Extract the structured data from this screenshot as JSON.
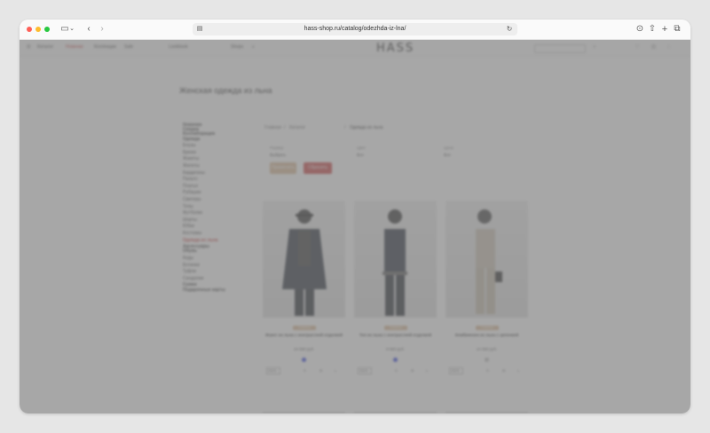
{
  "browser": {
    "url": "hass-shop.ru/catalog/odezhda-iz-lna/",
    "traffic_lights": {
      "close": "#ff5f57",
      "minimize": "#febc2e",
      "zoom": "#28c840"
    },
    "icons": [
      "sidebar-icon",
      "chevron-down-icon",
      "back-icon",
      "forward-icon",
      "site-info-icon",
      "reload-icon",
      "download-icon",
      "share-icon",
      "new-tab-icon",
      "tabs-icon"
    ]
  },
  "site": {
    "logo": "HASS",
    "nav": [
      "Каталог",
      "Новинки",
      "Коллекции",
      "Sale",
      "Lookbook",
      "Shops"
    ],
    "nav_icons": [
      "search-icon",
      "account-icon",
      "favorites-icon",
      "cart-icon"
    ],
    "accent_color": "#c83a3a",
    "badge_color": "#d9b58f"
  },
  "page_title": "Женская одежда из льна",
  "sidebar": {
    "categories": [
      {
        "label": "Новинки",
        "style": "bold"
      },
      {
        "label": "Скидки",
        "style": "bold"
      },
      {
        "label": "Коллаборация",
        "style": "bold"
      },
      {
        "label": "Одежда",
        "style": "bold"
      },
      {
        "label": "Блузы",
        "style": "normal"
      },
      {
        "label": "Брюки",
        "style": "normal"
      },
      {
        "label": "Жакеты",
        "style": "normal"
      },
      {
        "label": "Жилеты",
        "style": "normal"
      },
      {
        "label": "Кардиганы",
        "style": "normal"
      },
      {
        "label": "Пальто",
        "style": "normal"
      },
      {
        "label": "Платья",
        "style": "normal"
      },
      {
        "label": "Рубашки",
        "style": "normal"
      },
      {
        "label": "Свитеры",
        "style": "normal"
      },
      {
        "label": "Топы",
        "style": "normal"
      },
      {
        "label": "Футболки",
        "style": "normal"
      },
      {
        "label": "Шорты",
        "style": "normal"
      },
      {
        "label": "Юбки",
        "style": "normal"
      },
      {
        "label": "Костюмы",
        "style": "normal"
      },
      {
        "label": "Одежда из льна",
        "style": "active"
      },
      {
        "label": "Аксессуары",
        "style": "bold"
      },
      {
        "label": "Обувь",
        "style": "bold"
      },
      {
        "label": "Кеды",
        "style": "normal"
      },
      {
        "label": "Ботинки",
        "style": "normal"
      },
      {
        "label": "Туфли",
        "style": "normal"
      },
      {
        "label": "Сандалии",
        "style": "normal"
      },
      {
        "label": "Сумки",
        "style": "bold"
      },
      {
        "label": "Подарочные карты",
        "style": "bold"
      }
    ]
  },
  "breadcrumbs": [
    "Главная",
    "Каталог",
    "Одежда из льна"
  ],
  "filters": [
    {
      "label": "Размер",
      "value": "Выбрать"
    },
    {
      "label": "Цвет",
      "value": "Все"
    },
    {
      "label": "Цена",
      "value": "Все"
    }
  ],
  "buttons": {
    "apply": "Применить",
    "reset": "Сбросить"
  },
  "products": [
    {
      "badge": "Новинка",
      "name": "Жакет из льна с контрастной отделкой",
      "price": "16 990 руб.",
      "swatch": "#2233dd",
      "sizes": [
        "XS/S",
        "S",
        "M",
        "L"
      ]
    },
    {
      "badge": "Новинка",
      "name": "Топ из льна с контрастной отделкой",
      "price": "9 990 руб.",
      "swatch": "#2233dd",
      "sizes": [
        "XS/S",
        "S",
        "M",
        "L"
      ]
    },
    {
      "badge": "Новинка",
      "name": "Комбинезон из льна с цепочкой",
      "price": "14 990 руб.",
      "swatch": "#bbbbbb",
      "sizes": [
        "XS/S",
        "S",
        "M",
        "L"
      ]
    }
  ]
}
